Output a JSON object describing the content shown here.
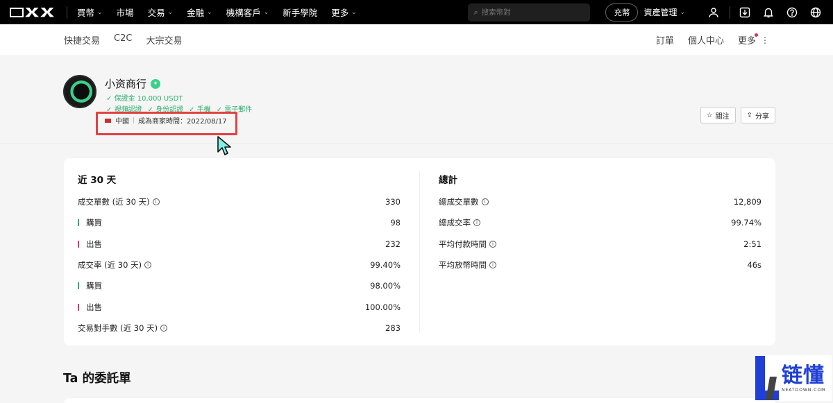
{
  "topnav": {
    "items": [
      {
        "label": "買幣",
        "has_dropdown": true
      },
      {
        "label": "市場",
        "has_dropdown": false
      },
      {
        "label": "交易",
        "has_dropdown": true
      },
      {
        "label": "金融",
        "has_dropdown": true
      },
      {
        "label": "機構客戶",
        "has_dropdown": true
      },
      {
        "label": "新手學院",
        "has_dropdown": false
      },
      {
        "label": "更多",
        "has_dropdown": true
      }
    ],
    "search_placeholder": "搜索幣對",
    "deposit_label": "充幣",
    "asset_label": "資產管理"
  },
  "subnav": {
    "left": [
      "快捷交易",
      "C2C",
      "大宗交易"
    ],
    "right": [
      "訂單",
      "個人中心",
      "更多"
    ]
  },
  "profile": {
    "name": "小资商行",
    "deposit": "保證金 10,000 USDT",
    "verifications": [
      "視頻認證",
      "身份認證",
      "手機",
      "電子郵件"
    ],
    "country": "中國",
    "merchant_since": "成為商家時間：2022/08/17",
    "follow_label": "關注",
    "share_label": "分享"
  },
  "stats_30d": {
    "title": "近 30 天",
    "rows": [
      {
        "label": "成交單數 (近 30 天)",
        "value": "330",
        "kind": "main"
      },
      {
        "label": "購買",
        "value": "98",
        "kind": "buy"
      },
      {
        "label": "出售",
        "value": "232",
        "kind": "sell"
      },
      {
        "label": "成交率 (近 30 天)",
        "value": "99.40%",
        "kind": "main"
      },
      {
        "label": "購買",
        "value": "98.00%",
        "kind": "buy"
      },
      {
        "label": "出售",
        "value": "100.00%",
        "kind": "sell"
      },
      {
        "label": "交易對手數 (近 30 天)",
        "value": "283",
        "kind": "main"
      }
    ]
  },
  "stats_total": {
    "title": "總計",
    "rows": [
      {
        "label": "總成交單數",
        "value": "12,809"
      },
      {
        "label": "總成交率",
        "value": "99.74%"
      },
      {
        "label": "平均付款時間",
        "value": "2:51"
      },
      {
        "label": "平均放幣時間",
        "value": "46s"
      }
    ]
  },
  "orders_title": "Ta 的委託單",
  "watermark": {
    "cn": "链懂",
    "en": "NEATDOWN.COM"
  },
  "colors": {
    "buy": "#2fb070",
    "sell": "#d93a78",
    "highlight": "#e2403f",
    "accent_green": "#3ad08a"
  }
}
